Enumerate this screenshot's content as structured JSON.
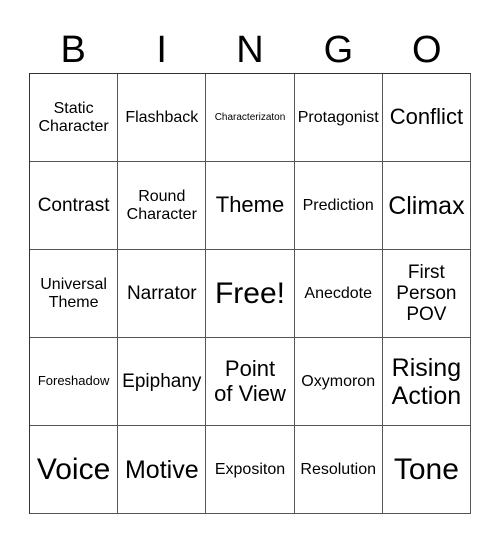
{
  "header": {
    "letters": [
      "B",
      "I",
      "N",
      "G",
      "O"
    ]
  },
  "grid": {
    "rows": [
      [
        {
          "text": "Static\nCharacter",
          "size": "md"
        },
        {
          "text": "Flashback",
          "size": "md"
        },
        {
          "text": "Characterizaton",
          "size": "xs"
        },
        {
          "text": "Protagonist",
          "size": "md"
        },
        {
          "text": "Conflict",
          "size": "xl"
        }
      ],
      [
        {
          "text": "Contrast",
          "size": "lg"
        },
        {
          "text": "Round\nCharacter",
          "size": "md"
        },
        {
          "text": "Theme",
          "size": "xl"
        },
        {
          "text": "Prediction",
          "size": "md"
        },
        {
          "text": "Climax",
          "size": "xxl"
        }
      ],
      [
        {
          "text": "Universal\nTheme",
          "size": "md"
        },
        {
          "text": "Narrator",
          "size": "lg"
        },
        {
          "text": "Free!",
          "size": "huge"
        },
        {
          "text": "Anecdote",
          "size": "md"
        },
        {
          "text": "First\nPerson\nPOV",
          "size": "lg"
        }
      ],
      [
        {
          "text": "Foreshadow",
          "size": "sm"
        },
        {
          "text": "Epiphany",
          "size": "lg"
        },
        {
          "text": "Point\nof View",
          "size": "xl"
        },
        {
          "text": "Oxymoron",
          "size": "md"
        },
        {
          "text": "Rising\nAction",
          "size": "xxl"
        }
      ],
      [
        {
          "text": "Voice",
          "size": "huge"
        },
        {
          "text": "Motive",
          "size": "xxl"
        },
        {
          "text": "Expositon",
          "size": "md"
        },
        {
          "text": "Resolution",
          "size": "md"
        },
        {
          "text": "Tone",
          "size": "huge"
        }
      ]
    ]
  }
}
